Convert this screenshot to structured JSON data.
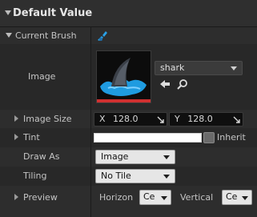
{
  "section": {
    "title": "Default Value"
  },
  "current_brush": {
    "label": "Current Brush"
  },
  "image": {
    "label": "Image",
    "asset_name": "shark"
  },
  "image_size": {
    "label": "Image Size",
    "x_label": "X",
    "x_value": "128.0",
    "y_label": "Y",
    "y_value": "128.0"
  },
  "tint": {
    "label": "Tint",
    "inherit_label": "Inherit"
  },
  "draw_as": {
    "label": "Draw As",
    "value": "Image"
  },
  "tiling": {
    "label": "Tiling",
    "value": "No Tile"
  },
  "preview": {
    "label": "Preview",
    "horizontal_label": "Horizon",
    "horizontal_value": "Ce",
    "vertical_label": "Vertical",
    "vertical_value": "Ce"
  },
  "icons": [
    "expand-arrow-icon",
    "brush-icon",
    "shark-fin-thumbnail",
    "use-selected-arrow-icon",
    "browse-magnifier-icon",
    "dropdown-chevron-icon",
    "reset-corner-icon"
  ],
  "colors": {
    "background": "#242424",
    "header": "#2f2f2f",
    "thumb_blue": "#2aa0e6",
    "thumb_red": "#d03030",
    "tint": "#ffffff"
  }
}
